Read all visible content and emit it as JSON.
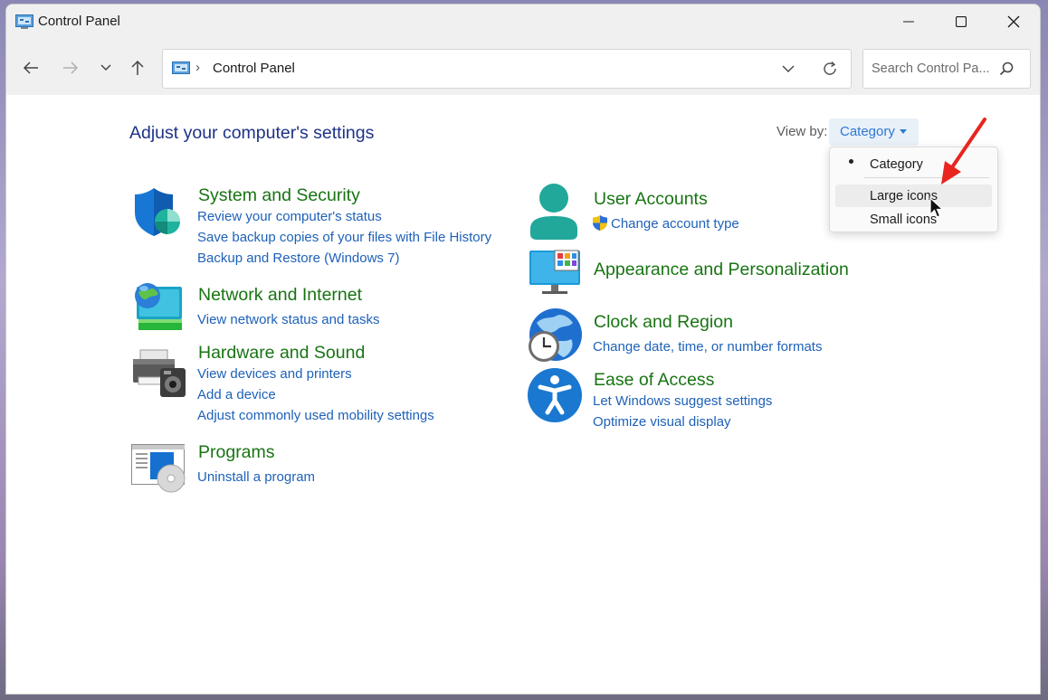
{
  "window": {
    "title": "Control Panel",
    "controls": [
      "minimize-icon",
      "maximize-icon",
      "close-icon"
    ]
  },
  "nav": {
    "back": "arrow-left-icon",
    "forward": "arrow-right-icon",
    "recent": "chevron-down-icon",
    "up": "arrow-up-icon"
  },
  "address": {
    "path": "Control Panel",
    "separator": "›"
  },
  "search": {
    "placeholder": "Search Control Pa..."
  },
  "content": {
    "heading": "Adjust your computer's settings",
    "view_by_label": "View by:",
    "view_by_value": "Category"
  },
  "view_menu": {
    "items": [
      {
        "label": "Category",
        "selected": true
      },
      {
        "label": "Large icons",
        "hovered": true
      },
      {
        "label": "Small icons"
      }
    ]
  },
  "categories": {
    "system": {
      "title": "System and Security",
      "links": [
        "Review your computer's status",
        "Save backup copies of your files with File History",
        "Backup and Restore (Windows 7)"
      ]
    },
    "network": {
      "title": "Network and Internet",
      "links": [
        "View network status and tasks"
      ]
    },
    "hardware": {
      "title": "Hardware and Sound",
      "links": [
        "View devices and printers",
        "Add a device",
        "Adjust commonly used mobility settings"
      ]
    },
    "programs": {
      "title": "Programs",
      "links": [
        "Uninstall a program"
      ]
    },
    "users": {
      "title": "User Accounts",
      "links": [
        "Change account type"
      ]
    },
    "appearance": {
      "title": "Appearance and Personalization",
      "links": []
    },
    "clock": {
      "title": "Clock and Region",
      "links": [
        "Change date, time, or number formats"
      ]
    },
    "ease": {
      "title": "Ease of Access",
      "links": [
        "Let Windows suggest settings",
        "Optimize visual display"
      ]
    }
  },
  "colors": {
    "heading": "#1e3287",
    "category_title": "#187413",
    "link": "#1e61b8",
    "annotation_arrow": "#e8251f"
  }
}
